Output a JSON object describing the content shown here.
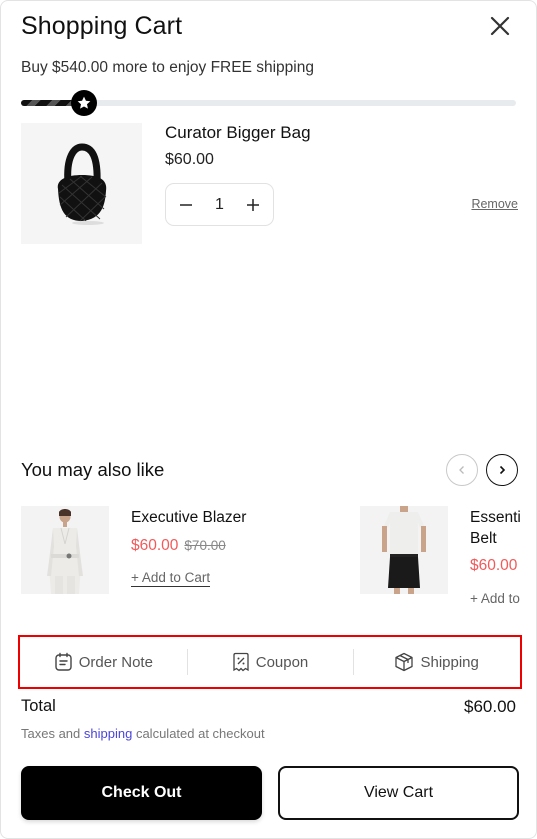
{
  "header": {
    "title": "Shopping Cart",
    "close_icon": "close-icon"
  },
  "free_shipping": {
    "message": "Buy $540.00 more to enjoy FREE shipping",
    "progress_fraction": 0.1,
    "marker_icon": "star-icon"
  },
  "cart": {
    "items": [
      {
        "name": "Curator Bigger Bag",
        "price": "$60.00",
        "quantity": "1",
        "remove_label": "Remove",
        "image": "black-quilted-bag"
      }
    ]
  },
  "recommendations": {
    "title": "You may also like",
    "prev_icon": "chevron-left-icon",
    "next_icon": "chevron-right-icon",
    "items": [
      {
        "name": "Executive Blazer",
        "price": "$60.00",
        "compare_price": "$70.00",
        "add_label": "+ Add to Cart",
        "image": "white-blazer"
      },
      {
        "name": "Essenti\nBelt",
        "name_line1": "Essenti",
        "name_line2": "Belt",
        "price": "$60.00",
        "add_label": "+ Add to Cart",
        "image": "white-tee-black-skirt"
      }
    ]
  },
  "tools": [
    {
      "label": "Order Note",
      "icon": "note-icon"
    },
    {
      "label": "Coupon",
      "icon": "coupon-icon"
    },
    {
      "label": "Shipping",
      "icon": "box-icon"
    }
  ],
  "summary": {
    "total_label": "Total",
    "total_value": "$60.00",
    "tax_prefix": "Taxes and",
    "tax_link": "shipping",
    "tax_suffix": "calculated at checkout"
  },
  "actions": {
    "checkout_label": "Check Out",
    "view_cart_label": "View Cart"
  },
  "colors": {
    "accent": "#000000",
    "sale_price": "#f25a5a",
    "link": "#4a44d9",
    "highlight_border": "#ee0000"
  }
}
